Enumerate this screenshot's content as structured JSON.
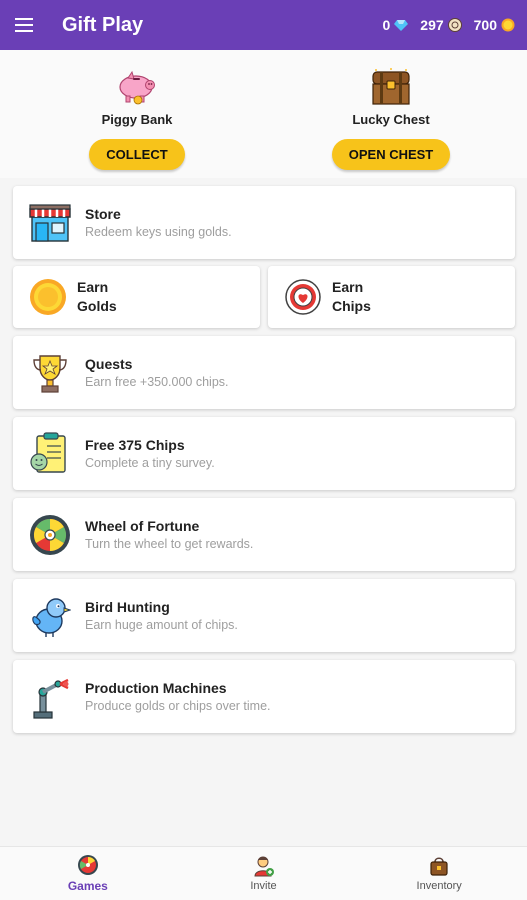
{
  "app": {
    "title": "Gift Play"
  },
  "header": {
    "diamonds": "0",
    "chips": "297",
    "golds": "700"
  },
  "rewards": {
    "piggy": {
      "label": "Piggy Bank",
      "button": "COLLECT"
    },
    "chest": {
      "label": "Lucky Chest",
      "button": "OPEN CHEST"
    }
  },
  "cards": {
    "store": {
      "title": "Store",
      "subtitle": "Redeem keys using golds."
    },
    "earn_golds": {
      "line1": "Earn",
      "line2": "Golds"
    },
    "earn_chips": {
      "line1": "Earn",
      "line2": "Chips"
    },
    "quests": {
      "title": "Quests",
      "subtitle": "Earn free +350.000 chips."
    },
    "survey": {
      "title": "Free 375 Chips",
      "subtitle": "Complete a tiny survey."
    },
    "wheel": {
      "title": "Wheel of Fortune",
      "subtitle": "Turn the wheel to get rewards."
    },
    "bird": {
      "title": "Bird Hunting",
      "subtitle": "Earn huge amount of chips."
    },
    "production": {
      "title": "Production Machines",
      "subtitle": "Produce golds or chips over time."
    }
  },
  "nav": {
    "games": "Games",
    "invite": "Invite",
    "inventory": "Inventory"
  },
  "colors": {
    "primary": "#6a3fb6",
    "accent": "#f7c31a"
  }
}
